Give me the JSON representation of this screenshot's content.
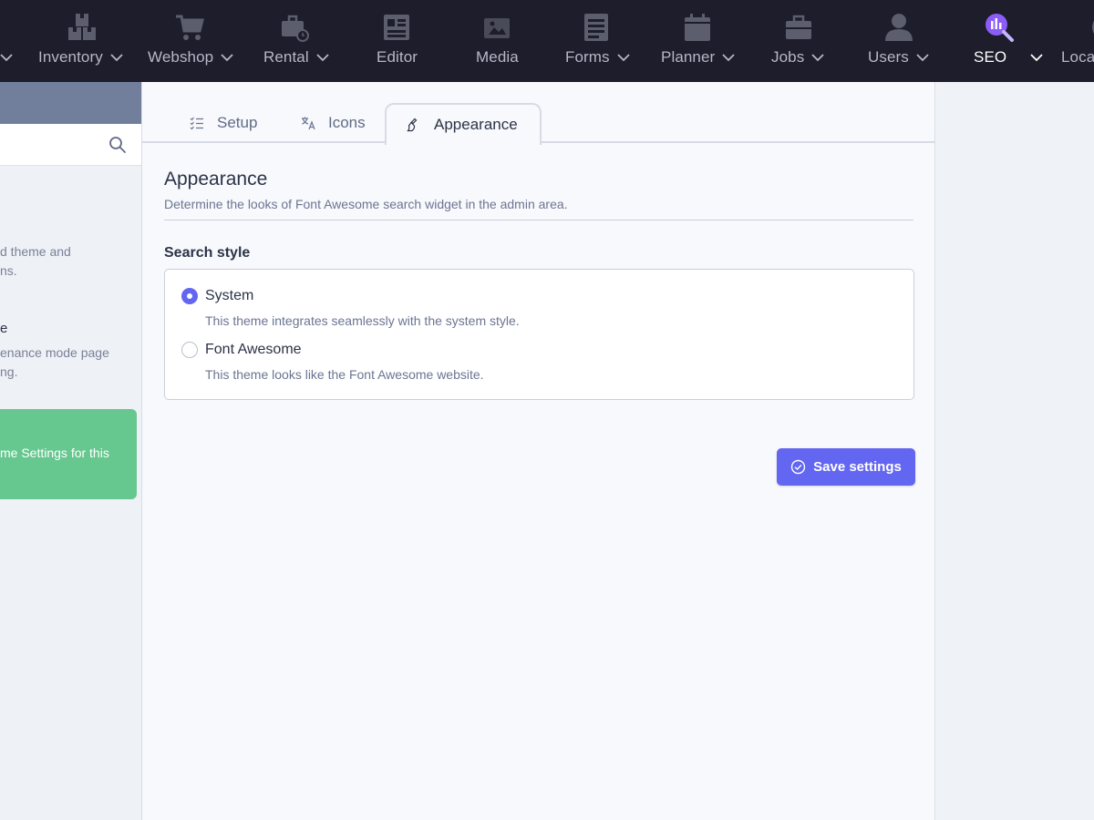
{
  "topnav": {
    "items": [
      {
        "label": "",
        "icon": "chevron-down-icon"
      },
      {
        "label": "Inventory",
        "icon": "boxes-icon"
      },
      {
        "label": "Webshop",
        "icon": "cart-icon"
      },
      {
        "label": "Rental",
        "icon": "briefcase-clock-icon"
      },
      {
        "label": "Editor",
        "icon": "editor-icon"
      },
      {
        "label": "Media",
        "icon": "media-icon"
      },
      {
        "label": "Forms",
        "icon": "forms-icon"
      },
      {
        "label": "Planner",
        "icon": "calendar-icon"
      },
      {
        "label": "Jobs",
        "icon": "briefcase-icon"
      },
      {
        "label": "Users",
        "icon": "user-icon"
      },
      {
        "label": "SEO",
        "icon": "seo-search-icon",
        "active": true
      },
      {
        "label": "Loca",
        "icon": "locale-icon"
      }
    ]
  },
  "sidebar": {
    "item1_line1": "d theme and",
    "item1_line2": "ns.",
    "item2_title": "e",
    "item2_line1": "enance mode page",
    "item2_line2": "ng.",
    "notice_text": "me Settings for this"
  },
  "tabs": [
    {
      "label": "Setup",
      "icon": "checklist-icon"
    },
    {
      "label": "Icons",
      "icon": "translate-icon"
    },
    {
      "label": "Appearance",
      "icon": "brush-icon",
      "active": true
    }
  ],
  "section": {
    "title": "Appearance",
    "description": "Determine the looks of Font Awesome search widget in the admin area."
  },
  "search_style": {
    "label": "Search style",
    "options": [
      {
        "label": "System",
        "description": "This theme integrates seamlessly with the system style.",
        "checked": true
      },
      {
        "label": "Font Awesome",
        "description": "This theme looks like the Font Awesome website.",
        "checked": false
      }
    ]
  },
  "save_button": {
    "label": "Save settings"
  },
  "colors": {
    "accent": "#6366f1",
    "nav_bg": "#1d1d2b",
    "notice": "#66c78f",
    "seo_icon": "#8b5cf6"
  }
}
